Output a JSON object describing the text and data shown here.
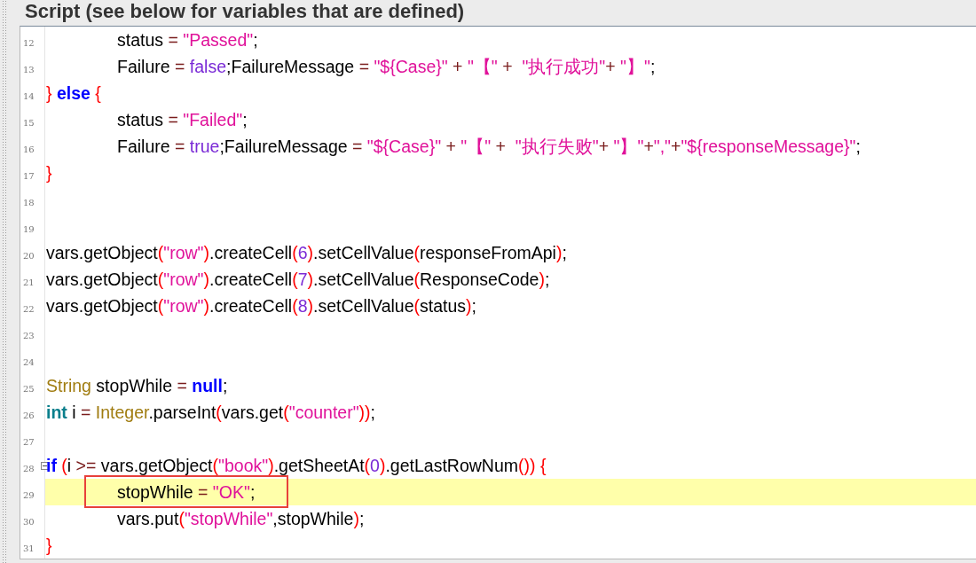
{
  "panel": {
    "title": "Script (see below for variables that are defined)"
  },
  "lines": [
    {
      "number": "12",
      "highlighted": false,
      "boxed": false,
      "foldable": false,
      "tokens": [
        {
          "kind": "id",
          "t": "\tstatus "
        },
        {
          "kind": "op",
          "t": "= "
        },
        {
          "kind": "str",
          "t": "\"Passed\""
        },
        {
          "kind": "id",
          "t": ";"
        }
      ]
    },
    {
      "number": "13",
      "highlighted": false,
      "boxed": false,
      "foldable": false,
      "tokens": [
        {
          "kind": "id",
          "t": "\tFailure "
        },
        {
          "kind": "op",
          "t": "= "
        },
        {
          "kind": "lit",
          "t": "false"
        },
        {
          "kind": "id",
          "t": ";FailureMessage "
        },
        {
          "kind": "op",
          "t": "= "
        },
        {
          "kind": "str",
          "t": "\"${Case}\""
        },
        {
          "kind": "op",
          "t": " + "
        },
        {
          "kind": "str",
          "t": "\"【\""
        },
        {
          "kind": "op",
          "t": " +  "
        },
        {
          "kind": "str",
          "t": "\"执行成功\""
        },
        {
          "kind": "op",
          "t": "+ "
        },
        {
          "kind": "str",
          "t": "\"】\""
        },
        {
          "kind": "id",
          "t": ";"
        }
      ]
    },
    {
      "number": "14",
      "highlighted": false,
      "boxed": false,
      "foldable": false,
      "tokens": [
        {
          "kind": "paren",
          "t": "} "
        },
        {
          "kind": "kw",
          "t": "else"
        },
        {
          "kind": "paren",
          "t": " {"
        }
      ]
    },
    {
      "number": "15",
      "highlighted": false,
      "boxed": false,
      "foldable": false,
      "tokens": [
        {
          "kind": "id",
          "t": "\tstatus "
        },
        {
          "kind": "op",
          "t": "= "
        },
        {
          "kind": "str",
          "t": "\"Failed\""
        },
        {
          "kind": "id",
          "t": ";"
        }
      ]
    },
    {
      "number": "16",
      "highlighted": false,
      "boxed": false,
      "foldable": false,
      "tokens": [
        {
          "kind": "id",
          "t": "\tFailure "
        },
        {
          "kind": "op",
          "t": "= "
        },
        {
          "kind": "lit",
          "t": "true"
        },
        {
          "kind": "id",
          "t": ";FailureMessage "
        },
        {
          "kind": "op",
          "t": "= "
        },
        {
          "kind": "str",
          "t": "\"${Case}\""
        },
        {
          "kind": "op",
          "t": " + "
        },
        {
          "kind": "str",
          "t": "\"【\""
        },
        {
          "kind": "op",
          "t": " +  "
        },
        {
          "kind": "str",
          "t": "\"执行失败\""
        },
        {
          "kind": "op",
          "t": "+ "
        },
        {
          "kind": "str",
          "t": "\"】\""
        },
        {
          "kind": "op",
          "t": "+"
        },
        {
          "kind": "str",
          "t": "\",\""
        },
        {
          "kind": "op",
          "t": "+"
        },
        {
          "kind": "str",
          "t": "\"${responseMessage}\""
        },
        {
          "kind": "id",
          "t": ";"
        }
      ]
    },
    {
      "number": "17",
      "highlighted": false,
      "boxed": false,
      "foldable": false,
      "tokens": [
        {
          "kind": "paren",
          "t": "}"
        }
      ]
    },
    {
      "number": "18",
      "highlighted": false,
      "boxed": false,
      "foldable": false
    },
    {
      "number": "19",
      "highlighted": false,
      "boxed": false,
      "foldable": false
    },
    {
      "number": "20",
      "highlighted": false,
      "boxed": false,
      "foldable": false,
      "tokens": [
        {
          "kind": "id",
          "t": "vars.getObject"
        },
        {
          "kind": "paren",
          "t": "("
        },
        {
          "kind": "str",
          "t": "\"row\""
        },
        {
          "kind": "paren",
          "t": ")"
        },
        {
          "kind": "id",
          "t": ".createCell"
        },
        {
          "kind": "paren",
          "t": "("
        },
        {
          "kind": "lit",
          "t": "6"
        },
        {
          "kind": "paren",
          "t": ")"
        },
        {
          "kind": "id",
          "t": ".setCellValue"
        },
        {
          "kind": "paren",
          "t": "("
        },
        {
          "kind": "id",
          "t": "responseFromApi"
        },
        {
          "kind": "paren",
          "t": ")"
        },
        {
          "kind": "id",
          "t": ";"
        }
      ]
    },
    {
      "number": "21",
      "highlighted": false,
      "boxed": false,
      "foldable": false,
      "tokens": [
        {
          "kind": "id",
          "t": "vars.getObject"
        },
        {
          "kind": "paren",
          "t": "("
        },
        {
          "kind": "str",
          "t": "\"row\""
        },
        {
          "kind": "paren",
          "t": ")"
        },
        {
          "kind": "id",
          "t": ".createCell"
        },
        {
          "kind": "paren",
          "t": "("
        },
        {
          "kind": "lit",
          "t": "7"
        },
        {
          "kind": "paren",
          "t": ")"
        },
        {
          "kind": "id",
          "t": ".setCellValue"
        },
        {
          "kind": "paren",
          "t": "("
        },
        {
          "kind": "id",
          "t": "ResponseCode"
        },
        {
          "kind": "paren",
          "t": ")"
        },
        {
          "kind": "id",
          "t": ";"
        }
      ]
    },
    {
      "number": "22",
      "highlighted": false,
      "boxed": false,
      "foldable": false,
      "tokens": [
        {
          "kind": "id",
          "t": "vars.getObject"
        },
        {
          "kind": "paren",
          "t": "("
        },
        {
          "kind": "str",
          "t": "\"row\""
        },
        {
          "kind": "paren",
          "t": ")"
        },
        {
          "kind": "id",
          "t": ".createCell"
        },
        {
          "kind": "paren",
          "t": "("
        },
        {
          "kind": "lit",
          "t": "8"
        },
        {
          "kind": "paren",
          "t": ")"
        },
        {
          "kind": "id",
          "t": ".setCellValue"
        },
        {
          "kind": "paren",
          "t": "("
        },
        {
          "kind": "id",
          "t": "status"
        },
        {
          "kind": "paren",
          "t": ")"
        },
        {
          "kind": "id",
          "t": ";"
        }
      ]
    },
    {
      "number": "23",
      "highlighted": false,
      "boxed": false,
      "foldable": false
    },
    {
      "number": "24",
      "highlighted": false,
      "boxed": false,
      "foldable": false
    },
    {
      "number": "25",
      "highlighted": false,
      "boxed": false,
      "foldable": false,
      "tokens": [
        {
          "kind": "type",
          "t": "String"
        },
        {
          "kind": "id",
          "t": " stopWhile "
        },
        {
          "kind": "op",
          "t": "= "
        },
        {
          "kind": "kw",
          "t": "null"
        },
        {
          "kind": "id",
          "t": ";"
        }
      ]
    },
    {
      "number": "26",
      "highlighted": false,
      "boxed": false,
      "foldable": false,
      "tokens": [
        {
          "kind": "prim",
          "t": "int"
        },
        {
          "kind": "id",
          "t": " i "
        },
        {
          "kind": "op",
          "t": "= "
        },
        {
          "kind": "type",
          "t": "Integer"
        },
        {
          "kind": "id",
          "t": ".parseInt"
        },
        {
          "kind": "paren",
          "t": "("
        },
        {
          "kind": "id",
          "t": "vars.get"
        },
        {
          "kind": "paren",
          "t": "("
        },
        {
          "kind": "str",
          "t": "\"counter\""
        },
        {
          "kind": "paren",
          "t": "))"
        },
        {
          "kind": "id",
          "t": ";"
        }
      ]
    },
    {
      "number": "27",
      "highlighted": false,
      "boxed": false,
      "foldable": false
    },
    {
      "number": "28",
      "highlighted": false,
      "boxed": false,
      "foldable": true,
      "tokens": [
        {
          "kind": "kw",
          "t": "if"
        },
        {
          "kind": "paren",
          "t": " ("
        },
        {
          "kind": "id",
          "t": "i "
        },
        {
          "kind": "op",
          "t": ">= "
        },
        {
          "kind": "id",
          "t": "vars.getObject"
        },
        {
          "kind": "paren",
          "t": "("
        },
        {
          "kind": "str",
          "t": "\"book\""
        },
        {
          "kind": "paren",
          "t": ")"
        },
        {
          "kind": "id",
          "t": ".getSheetAt"
        },
        {
          "kind": "paren",
          "t": "("
        },
        {
          "kind": "lit",
          "t": "0"
        },
        {
          "kind": "paren",
          "t": ")"
        },
        {
          "kind": "id",
          "t": ".getLastRowNum"
        },
        {
          "kind": "paren",
          "t": "())"
        },
        {
          "kind": "paren",
          "t": " {"
        }
      ]
    },
    {
      "number": "29",
      "highlighted": true,
      "boxed": true,
      "foldable": false,
      "tokens": [
        {
          "kind": "id",
          "t": "\tstopWhile "
        },
        {
          "kind": "op",
          "t": "= "
        },
        {
          "kind": "str",
          "t": "\"OK\""
        },
        {
          "kind": "id",
          "t": ";"
        }
      ]
    },
    {
      "number": "30",
      "highlighted": false,
      "boxed": false,
      "foldable": false,
      "tokens": [
        {
          "kind": "id",
          "t": "\tvars.put"
        },
        {
          "kind": "paren",
          "t": "("
        },
        {
          "kind": "str",
          "t": "\"stopWhile\""
        },
        {
          "kind": "id",
          "t": ",stopWhile"
        },
        {
          "kind": "paren",
          "t": ")"
        },
        {
          "kind": "id",
          "t": ";"
        }
      ]
    },
    {
      "number": "31",
      "highlighted": false,
      "boxed": false,
      "foldable": false,
      "tokens": [
        {
          "kind": "paren",
          "t": "}"
        }
      ]
    }
  ]
}
